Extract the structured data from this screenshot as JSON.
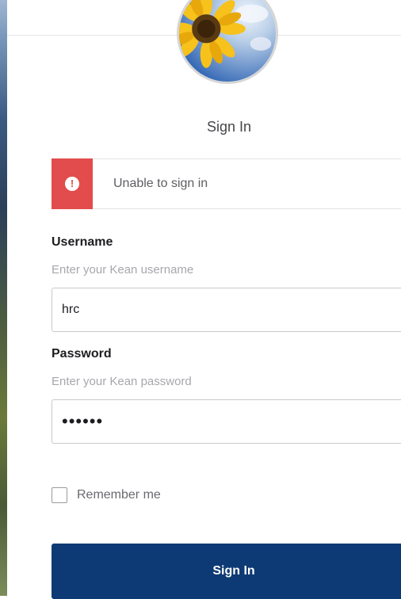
{
  "page": {
    "title": "Sign In"
  },
  "alert": {
    "message": "Unable to sign in",
    "icon": "exclamation-icon",
    "color": "#e24c4c"
  },
  "username": {
    "label": "Username",
    "hint": "Enter your Kean username",
    "value": "hrc"
  },
  "password": {
    "label": "Password",
    "hint": "Enter your Kean password",
    "value": "pwd123"
  },
  "remember": {
    "label": "Remember me",
    "checked": false
  },
  "submit": {
    "label": "Sign In",
    "color": "#0d3a74"
  },
  "logo": {
    "icon": "sunflower-logo"
  }
}
